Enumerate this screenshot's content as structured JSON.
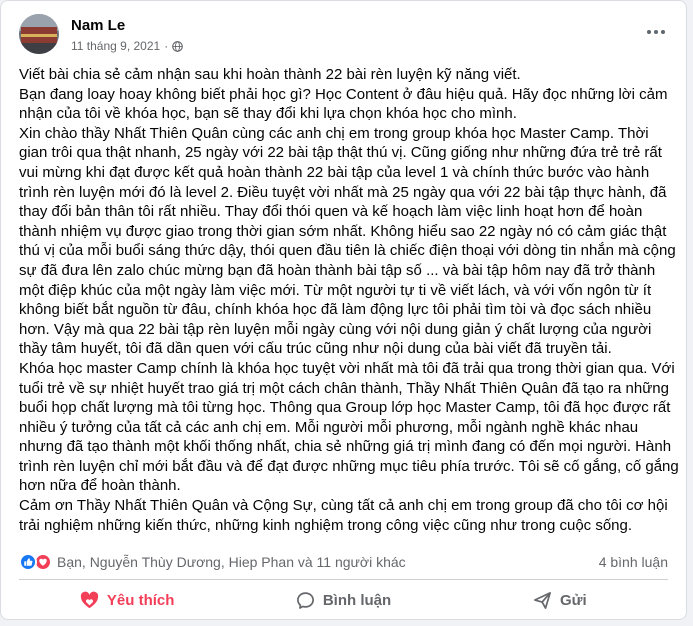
{
  "post": {
    "author": "Nam Le",
    "date": "11 tháng 9, 2021",
    "dot": "·",
    "paragraphs": [
      "Viết bài chia sẻ cảm nhận sau khi hoàn thành 22 bài rèn luyện kỹ năng viết.",
      "Bạn đang loay hoay không biết phải học gì? Học Content ở đâu hiệu quả. Hãy đọc những lời cảm nhận của tôi về khóa học, bạn sẽ thay đổi khi lựa chọn khóa học cho mình.",
      "Xin chào thầy Nhất Thiên Quân cùng các anh chị em trong group khóa học Master Camp. Thời gian trôi qua thật nhanh, 25 ngày với 22 bài tập thật thú vị. Cũng giống như những đứa trẻ trẻ rất vui mừng khi đạt được kết quả hoàn thành 22 bài tập của level 1 và chính thức bước vào hành trình rèn luyện mới đó là level 2. Điều tuyệt vời nhất mà 25 ngày qua với 22 bài tập thực hành, đã thay đổi bản thân tôi rất nhiều. Thay đổi thói quen và kế hoạch làm việc linh hoạt hơn để hoàn thành nhiệm vụ được giao trong thời gian sớm nhất. Không hiểu sao 22 ngày nó có cảm giác thật thú vị của mỗi buổi sáng thức dậy, thói quen đầu tiên là chiếc điện thoại với dòng tin nhắn mà cộng sự đã đưa lên zalo chúc mừng bạn đã hoàn thành bài tập số ... và bài tập hôm nay đã trở thành một điệp khúc của một ngày làm việc mới. Từ một người tự ti về viết lách, và với vốn ngôn từ ít không biết bắt nguồn từ đâu, chính khóa học đã làm động lực tôi phải tìm tòi và đọc sách nhiều hơn. Vậy mà qua 22 bài tập rèn luyện mỗi ngày cùng với nội dung giản ý chất lượng của người thầy tâm huyết, tôi đã dần quen với cấu trúc cũng như nội dung của bài viết đã truyền tải.",
      "Khóa học master Camp chính là khóa học tuyệt vời nhất mà tôi đã trải qua trong thời gian qua. Với tuổi trẻ về sự nhiệt huyết trao giá trị một cách chân thành, Thầy Nhất Thiên Quân đã tạo ra những buổi họp chất lượng mà tôi từng học. Thông qua Group lớp học Master Camp, tôi đã học được rất nhiều ý tưởng của tất cả các anh chị em. Mỗi người mỗi phương, mỗi ngành nghề khác nhau nhưng đã tạo thành một khối thống nhất, chia sẻ những giá trị mình đang có đến mọi người. Hành trình rèn luyện chỉ mới bắt đầu và để đạt được những mục tiêu phía trước. Tôi sẽ cố gắng, cố gắng hơn nữa để hoàn thành.",
      "Cảm ơn Thầy Nhất Thiên Quân và Cộng Sự, cùng tất cả anh chị em trong group đã cho tôi cơ hội trải nghiệm những kiến thức, những kinh nghiệm trong công việc cũng như trong cuộc sống."
    ]
  },
  "reactions": {
    "names": "Bạn, Nguyễn Thùy Dương, Hiep Phan và 11 người khác",
    "comments": "4 bình luận"
  },
  "actions": {
    "like": "Yêu thích",
    "comment": "Bình luận",
    "share": "Gửi"
  },
  "colors": {
    "like_blue": "#1877f2",
    "love_red": "#f33e58",
    "secondary_text": "#65676b"
  },
  "icons": [
    "globe-icon",
    "more-icon",
    "like-reaction-icon",
    "love-reaction-icon",
    "heart-icon",
    "comment-icon",
    "share-icon"
  ]
}
